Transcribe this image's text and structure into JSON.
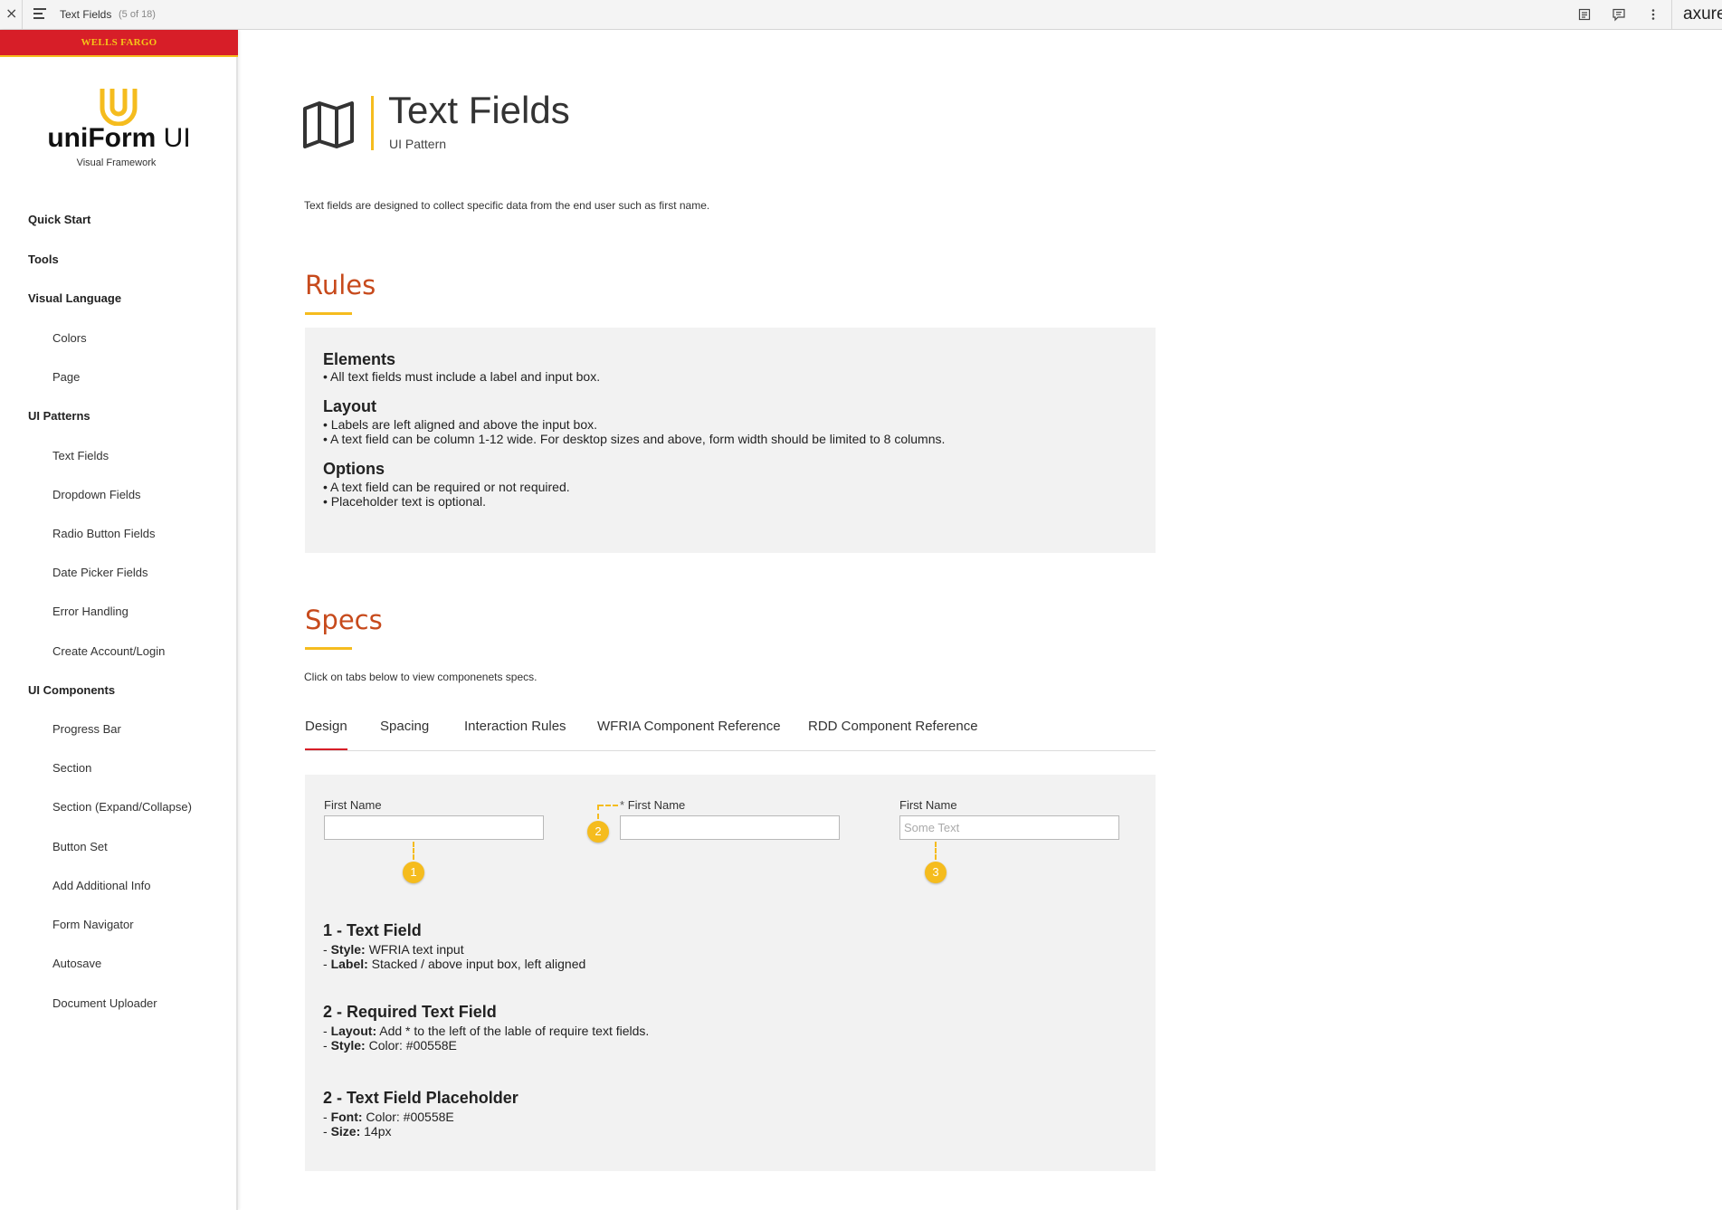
{
  "topbar": {
    "close": "×",
    "title": "Text Fields",
    "count": "(5 of 18)",
    "brand": "axure"
  },
  "sidebar": {
    "wf_logo": "WELLS FARGO",
    "logo_bold": "uniForm",
    "logo_light": " UI",
    "logo_sub": "Visual Framework",
    "items": [
      {
        "label": "Quick Start"
      },
      {
        "label": "Tools"
      },
      {
        "label": "Visual Language"
      },
      {
        "label": "Colors"
      },
      {
        "label": "Page"
      },
      {
        "label": "UI Patterns"
      },
      {
        "label": "Text Fields"
      },
      {
        "label": "Dropdown Fields"
      },
      {
        "label": "Radio Button Fields"
      },
      {
        "label": "Date Picker Fields"
      },
      {
        "label": "Error Handling"
      },
      {
        "label": "Create Account/Login"
      },
      {
        "label": "UI Components"
      },
      {
        "label": "Progress Bar"
      },
      {
        "label": "Section"
      },
      {
        "label": "Section (Expand/Collapse)"
      },
      {
        "label": "Button Set"
      },
      {
        "label": "Add Additional Info"
      },
      {
        "label": "Form Navigator"
      },
      {
        "label": "Autosave"
      },
      {
        "label": "Document Uploader"
      }
    ]
  },
  "header": {
    "title": "Text Fields",
    "subtitle": "UI Pattern"
  },
  "intro": "Text fields are designed to collect specific data from the end user such as first name.",
  "rules": {
    "heading": "Rules",
    "groups": [
      {
        "title": "Elements",
        "lines": [
          "• All text fields must include a label and input box."
        ]
      },
      {
        "title": "Layout",
        "lines": [
          "• Labels are left aligned and above the input box.",
          "• A text field can be column 1-12 wide. For desktop sizes and above, form width should be limited to 8 columns."
        ]
      },
      {
        "title": "Options",
        "lines": [
          "• A text field can be required or not required.",
          "• Placeholder text is optional."
        ]
      }
    ]
  },
  "specs": {
    "heading": "Specs",
    "note": "Click on tabs below to view componenets specs.",
    "tabs": [
      {
        "label": "Design"
      },
      {
        "label": "Spacing"
      },
      {
        "label": "Interaction Rules"
      },
      {
        "label": "WFRIA Component Reference"
      },
      {
        "label": "RDD Component Reference"
      }
    ],
    "fields": [
      {
        "label": "First Name",
        "value": "",
        "placeholder": "",
        "badge": "1"
      },
      {
        "star": "*",
        "label": "First Name",
        "value": "",
        "placeholder": "",
        "badge": "2"
      },
      {
        "label": "First Name",
        "value": "",
        "placeholder": "Some Text",
        "badge": "3"
      }
    ],
    "details": [
      {
        "title": "1 - Text Field",
        "lines": [
          {
            "prefix": "- ",
            "key": "Style:",
            "value": " WFRIA text input"
          },
          {
            "prefix": "- ",
            "key": "Label:",
            "value": " Stacked / above input box, left aligned"
          }
        ]
      },
      {
        "title": "2 - Required Text Field",
        "lines": [
          {
            "prefix": "- ",
            "key": "Layout:",
            "value": " Add * to the left of the lable of require text fields."
          },
          {
            "prefix": "- ",
            "key": "Style:",
            "value": " Color: #00558E"
          }
        ]
      },
      {
        "title": "2 - Text Field Placeholder",
        "lines": [
          {
            "prefix": "- ",
            "key": "Font:",
            "value": " Color: #00558E"
          },
          {
            "prefix": "- ",
            "key": "Size:",
            "value": " 14px"
          }
        ]
      }
    ]
  },
  "colors": {
    "accent_yellow": "#f5bc1e",
    "wf_red": "#d71e28",
    "section_heading": "#c74a1c",
    "tab_active": "#d71e28"
  }
}
